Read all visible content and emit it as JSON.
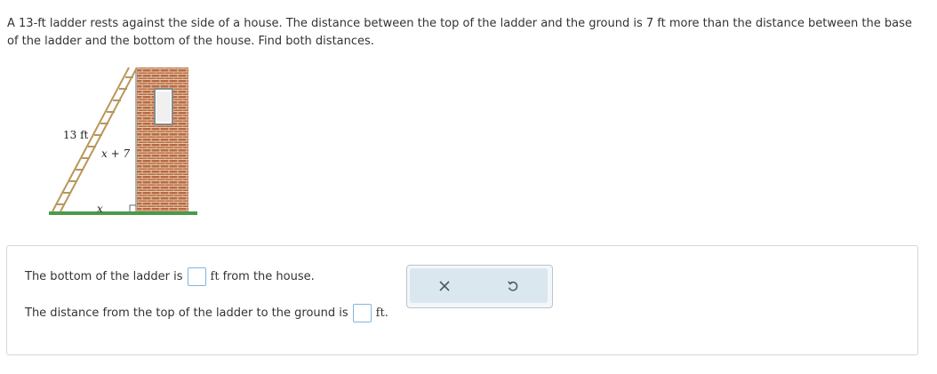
{
  "problem": {
    "text": "A 13-ft ladder rests against the side of a house. The distance between the top of the ladder and the ground is 7 ft more than the distance between the base of the ladder and the bottom of the house. Find both distances."
  },
  "figure": {
    "ladder_label": "13 ft",
    "height_label": "x + 7",
    "base_label": "x"
  },
  "answers": {
    "bottom_prefix": "The bottom of the ladder is",
    "bottom_unit": "ft",
    "bottom_suffix": "from the house.",
    "bottom_value": "",
    "top_prefix": "The distance from the top of the ladder to the ground is",
    "top_unit": "ft",
    "top_suffix": ".",
    "top_value": ""
  },
  "tools": {
    "clear_icon": "close-icon",
    "undo_icon": "undo-icon"
  }
}
